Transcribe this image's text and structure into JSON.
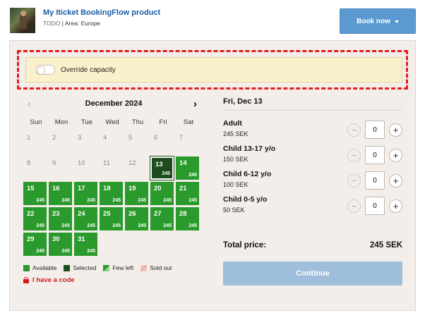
{
  "product": {
    "title": "My Iticket BookingFlow product",
    "todo": "TODO",
    "area": "Area: Europe"
  },
  "book_button": {
    "label": "Book now"
  },
  "override": {
    "label": "Override capacity",
    "enabled": false
  },
  "calendar": {
    "month": "December 2024",
    "weekdays": [
      "Sun",
      "Mon",
      "Tue",
      "Wed",
      "Thu",
      "Fri",
      "Sat"
    ],
    "weeks": [
      [
        {
          "day": "1",
          "state": "past",
          "price": ""
        },
        {
          "day": "2",
          "state": "past",
          "price": ""
        },
        {
          "day": "3",
          "state": "past",
          "price": ""
        },
        {
          "day": "4",
          "state": "past",
          "price": ""
        },
        {
          "day": "5",
          "state": "past",
          "price": ""
        },
        {
          "day": "6",
          "state": "past",
          "price": ""
        },
        {
          "day": "7",
          "state": "past",
          "price": ""
        }
      ],
      [
        {
          "day": "8",
          "state": "past",
          "price": ""
        },
        {
          "day": "9",
          "state": "past",
          "price": ""
        },
        {
          "day": "10",
          "state": "past",
          "price": ""
        },
        {
          "day": "11",
          "state": "past",
          "price": ""
        },
        {
          "day": "12",
          "state": "past",
          "price": ""
        },
        {
          "day": "13",
          "state": "selected",
          "price": "245"
        },
        {
          "day": "14",
          "state": "available",
          "price": "245"
        }
      ],
      [
        {
          "day": "15",
          "state": "available",
          "price": "245"
        },
        {
          "day": "16",
          "state": "available",
          "price": "245"
        },
        {
          "day": "17",
          "state": "available",
          "price": "245"
        },
        {
          "day": "18",
          "state": "available",
          "price": "245"
        },
        {
          "day": "19",
          "state": "available",
          "price": "245"
        },
        {
          "day": "20",
          "state": "available",
          "price": "245"
        },
        {
          "day": "21",
          "state": "available",
          "price": "245"
        }
      ],
      [
        {
          "day": "22",
          "state": "available",
          "price": "245"
        },
        {
          "day": "23",
          "state": "available",
          "price": "245"
        },
        {
          "day": "24",
          "state": "available",
          "price": "245"
        },
        {
          "day": "25",
          "state": "available",
          "price": "245"
        },
        {
          "day": "26",
          "state": "available",
          "price": "245"
        },
        {
          "day": "27",
          "state": "available",
          "price": "245"
        },
        {
          "day": "28",
          "state": "available",
          "price": "245"
        }
      ],
      [
        {
          "day": "29",
          "state": "available",
          "price": "245"
        },
        {
          "day": "30",
          "state": "available",
          "price": "245"
        },
        {
          "day": "31",
          "state": "available",
          "price": "245"
        }
      ]
    ]
  },
  "legend": {
    "available": "Available",
    "selected": "Selected",
    "few_left": "Few left",
    "sold_out": "Sold out"
  },
  "code_link": "I have a code",
  "selected_date": "Fri, Dec 13",
  "tickets": [
    {
      "name": "Adult",
      "price": "245 SEK",
      "qty": "0"
    },
    {
      "name": "Child 13-17 y/o",
      "price": "150 SEK",
      "qty": "0"
    },
    {
      "name": "Child 6-12 y/o",
      "price": "100 SEK",
      "qty": "0"
    },
    {
      "name": "Child 0-5 y/o",
      "price": "50 SEK",
      "qty": "0"
    }
  ],
  "total": {
    "label": "Total price:",
    "value": "245 SEK"
  },
  "continue_label": "Continue",
  "colors": {
    "available": "#2a9a2c",
    "selected": "#1d4d1f",
    "accent": "#5a9ad0",
    "highlight": "#e02020"
  },
  "icons": {
    "prev": "chevron-left-icon",
    "next": "chevron-right-icon",
    "lock": "lock-icon",
    "minus": "minus-icon",
    "plus": "plus-icon"
  }
}
